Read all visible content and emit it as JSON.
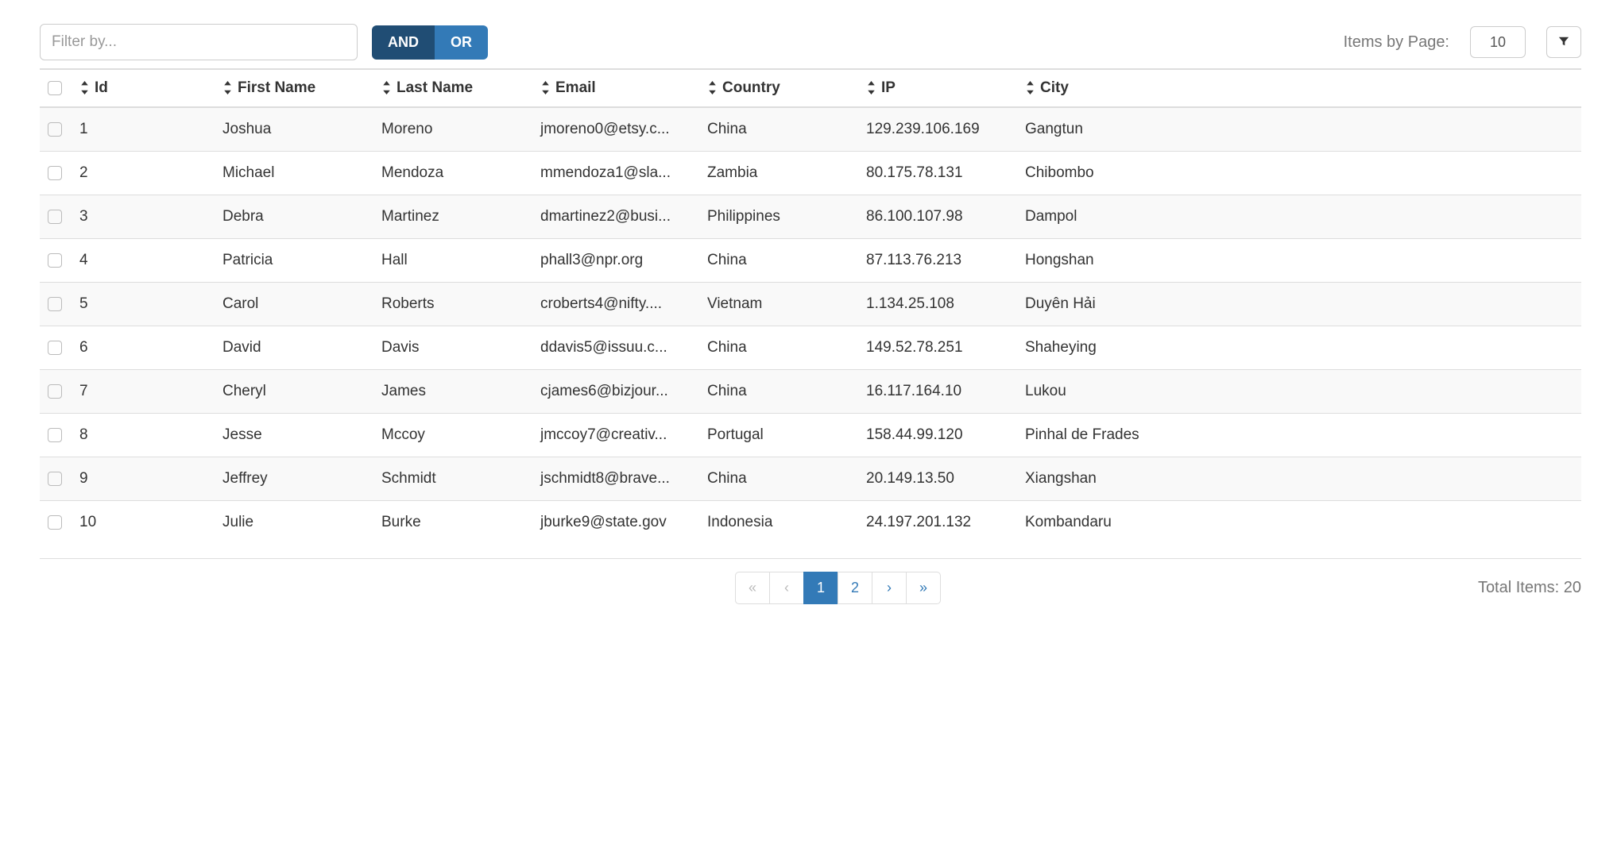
{
  "toolbar": {
    "filter_placeholder": "Filter by...",
    "and_label": "AND",
    "or_label": "OR",
    "items_by_page_label": "Items by Page:",
    "items_by_page_value": "10"
  },
  "columns": [
    {
      "key": "id",
      "label": "Id"
    },
    {
      "key": "first_name",
      "label": "First Name"
    },
    {
      "key": "last_name",
      "label": "Last Name"
    },
    {
      "key": "email",
      "label": "Email"
    },
    {
      "key": "country",
      "label": "Country"
    },
    {
      "key": "ip",
      "label": "IP"
    },
    {
      "key": "city",
      "label": "City"
    }
  ],
  "rows": [
    {
      "id": "1",
      "first_name": "Joshua",
      "last_name": "Moreno",
      "email": "jmoreno0@etsy.c...",
      "country": "China",
      "ip": "129.239.106.169",
      "city": "Gangtun"
    },
    {
      "id": "2",
      "first_name": "Michael",
      "last_name": "Mendoza",
      "email": "mmendoza1@sla...",
      "country": "Zambia",
      "ip": "80.175.78.131",
      "city": "Chibombo"
    },
    {
      "id": "3",
      "first_name": "Debra",
      "last_name": "Martinez",
      "email": "dmartinez2@busi...",
      "country": "Philippines",
      "ip": "86.100.107.98",
      "city": "Dampol"
    },
    {
      "id": "4",
      "first_name": "Patricia",
      "last_name": "Hall",
      "email": "phall3@npr.org",
      "country": "China",
      "ip": "87.113.76.213",
      "city": "Hongshan"
    },
    {
      "id": "5",
      "first_name": "Carol",
      "last_name": "Roberts",
      "email": "croberts4@nifty....",
      "country": "Vietnam",
      "ip": "1.134.25.108",
      "city": "Duyên Hải"
    },
    {
      "id": "6",
      "first_name": "David",
      "last_name": "Davis",
      "email": "ddavis5@issuu.c...",
      "country": "China",
      "ip": "149.52.78.251",
      "city": "Shaheying"
    },
    {
      "id": "7",
      "first_name": "Cheryl",
      "last_name": "James",
      "email": "cjames6@bizjour...",
      "country": "China",
      "ip": "16.117.164.10",
      "city": "Lukou"
    },
    {
      "id": "8",
      "first_name": "Jesse",
      "last_name": "Mccoy",
      "email": "jmccoy7@creativ...",
      "country": "Portugal",
      "ip": "158.44.99.120",
      "city": "Pinhal de Frades"
    },
    {
      "id": "9",
      "first_name": "Jeffrey",
      "last_name": "Schmidt",
      "email": "jschmidt8@brave...",
      "country": "China",
      "ip": "20.149.13.50",
      "city": "Xiangshan"
    },
    {
      "id": "10",
      "first_name": "Julie",
      "last_name": "Burke",
      "email": "jburke9@state.gov",
      "country": "Indonesia",
      "ip": "24.197.201.132",
      "city": "Kombandaru"
    }
  ],
  "pagination": {
    "first": "«",
    "prev": "‹",
    "pages": [
      "1",
      "2"
    ],
    "next": "›",
    "last": "»",
    "current": "1"
  },
  "footer": {
    "total_label": "Total Items: 20"
  }
}
